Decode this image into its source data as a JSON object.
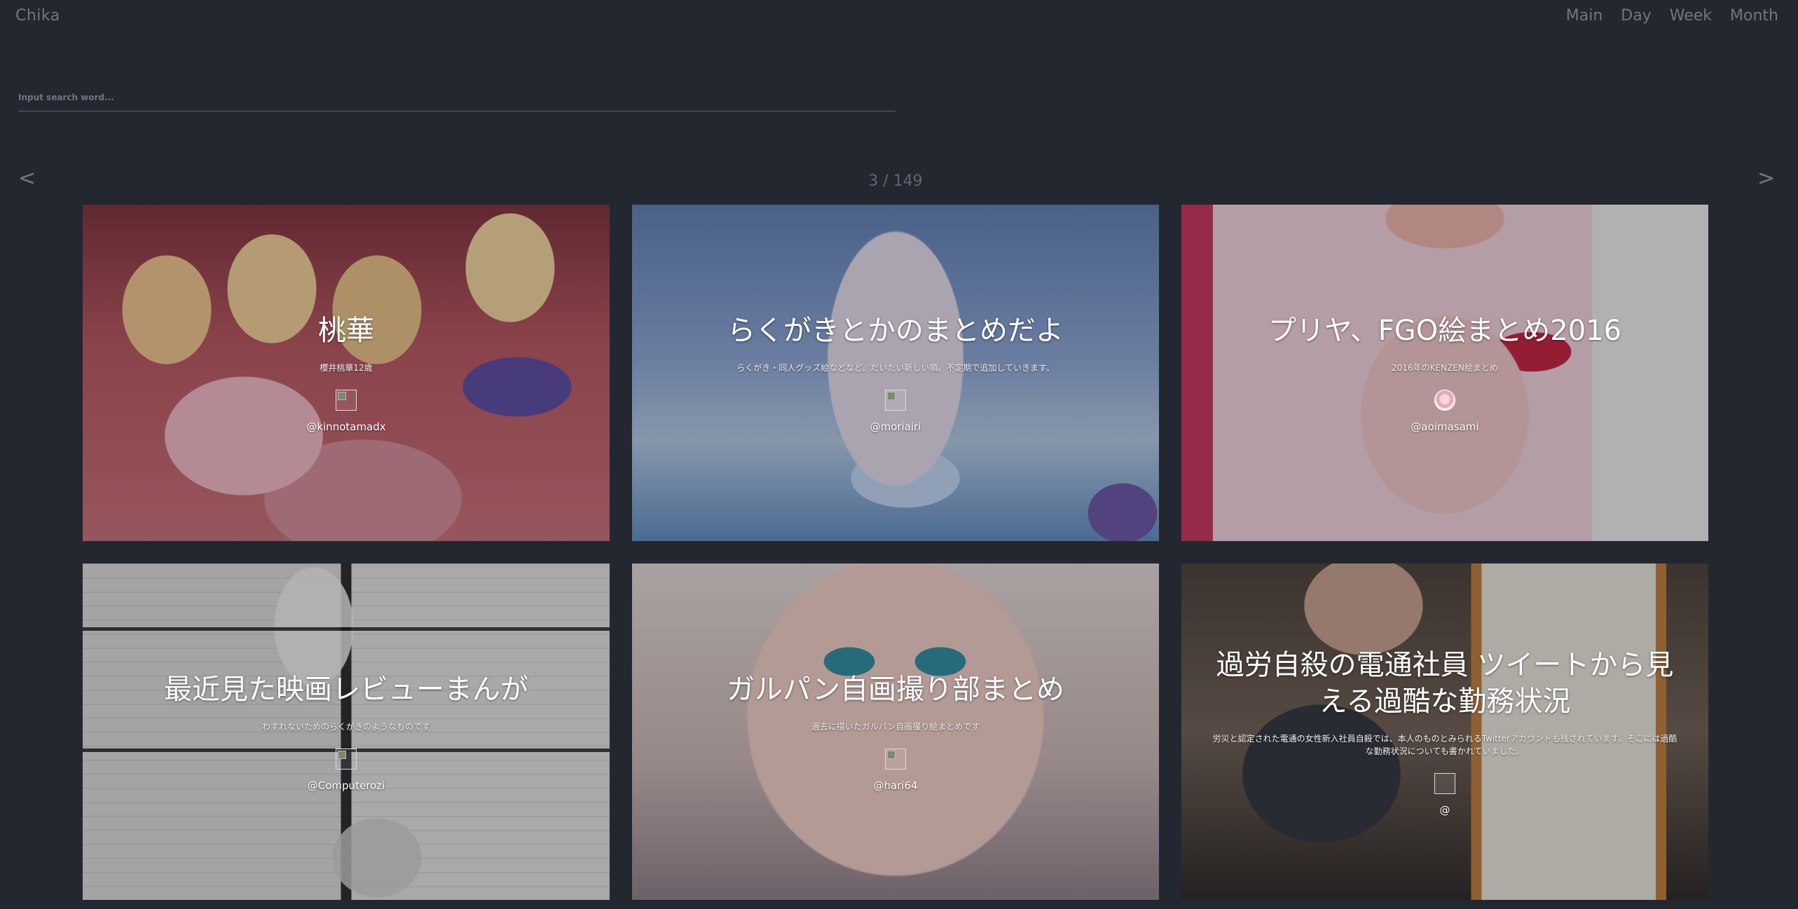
{
  "app": {
    "title": "Chika"
  },
  "nav": {
    "items": [
      {
        "label": "Main"
      },
      {
        "label": "Day"
      },
      {
        "label": "Week"
      },
      {
        "label": "Month"
      }
    ]
  },
  "search": {
    "placeholder": "Input search word...",
    "value": ""
  },
  "pager": {
    "prev_label": "<",
    "next_label": ">",
    "status": "3 / 149"
  },
  "cards": [
    {
      "title": "桃華",
      "description": "櫻井桃華12歳",
      "handle": "@kinnotamadx",
      "avatar": "broken-image"
    },
    {
      "title": "らくがきとかのまとめだよ",
      "description": "らくがき・同人グッズ絵などなど。だいたい新しい順。不定期で追加していきます。",
      "handle": "@moriairi",
      "avatar": "broken-image"
    },
    {
      "title": "プリヤ、FGO絵まとめ2016",
      "description": "2016年のKENZEN絵まとめ",
      "handle": "@aoimasami",
      "avatar": "profile-picture"
    },
    {
      "title": "最近見た映画レビューまんが",
      "description": "わすれないためのらくがきのようなものです",
      "handle": "@Computerozi",
      "avatar": "broken-image"
    },
    {
      "title": "ガルパン自画撮り部まとめ",
      "description": "過去に描いたガルパン自画撮り絵まとめです",
      "handle": "@hari64",
      "avatar": "broken-image"
    },
    {
      "title": "過労自殺の電通社員 ツイートから見える過酷な勤務状況",
      "description": "労災と認定された電通の女性新入社員自殺では、本人のものとみられるTwitterアカウントも残されています。そこには過酷な勤務状況についても書かれていました。",
      "handle": "@",
      "avatar": "empty"
    }
  ]
}
